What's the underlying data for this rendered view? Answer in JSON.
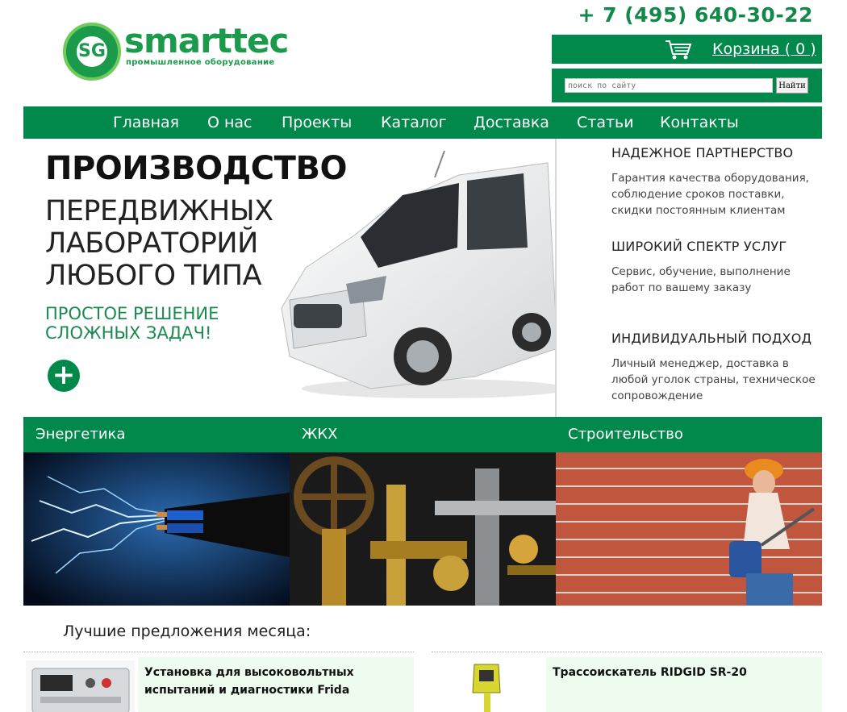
{
  "brand": {
    "name": "smarttec",
    "tagline": "промышленное оборудование",
    "mark": "SG"
  },
  "header": {
    "phone": "+ 7 (495) 640-30-22",
    "cart_label": "Корзина ( 0 )",
    "search_placeholder": "поиск по сайту",
    "search_button": "Найти"
  },
  "nav": {
    "items": [
      "Главная",
      "О нас",
      "Проекты",
      "Каталог",
      "Доставка",
      "Статьи",
      "Контакты"
    ]
  },
  "hero": {
    "title": "ПРОИЗВОДСТВО",
    "subtitle": "ПЕРЕДВИЖНЫХ\nЛАБОРАТОРИЙ\nЛЮБОГО ТИПА",
    "slogan": "ПРОСТОЕ РЕШЕНИЕ\nСЛОЖНЫХ ЗАДАЧ!",
    "plus": "+"
  },
  "features": [
    {
      "heading": "НАДЕЖНОЕ ПАРТНЕРСТВО",
      "text": "Гарантия качества оборудования, соблюдение сроков поставки, скидки постоянным клиентам"
    },
    {
      "heading": "ШИРОКИЙ СПЕКТР УСЛУГ",
      "text": "Сервис, обучение, выполнение работ по вашему заказу"
    },
    {
      "heading": "ИНДИВИДУАЛЬНЫЙ ПОДХОД",
      "text": "Личный менеджер, доставка в любой уголок страны, техническое сопровождение"
    }
  ],
  "categories": [
    "Энергетика",
    "ЖКХ",
    "Строительство"
  ],
  "offers": {
    "title": "Лучшие предложения месяца:",
    "items": [
      {
        "name": "Установка для высоковольтных испытаний и диагностики Frida"
      },
      {
        "name": "Трассоискатель RIDGID SR-20"
      }
    ]
  },
  "colors": {
    "brand_green": "#00894a",
    "light_green": "#6fcb5a",
    "offer_bg": "#eefcef"
  }
}
